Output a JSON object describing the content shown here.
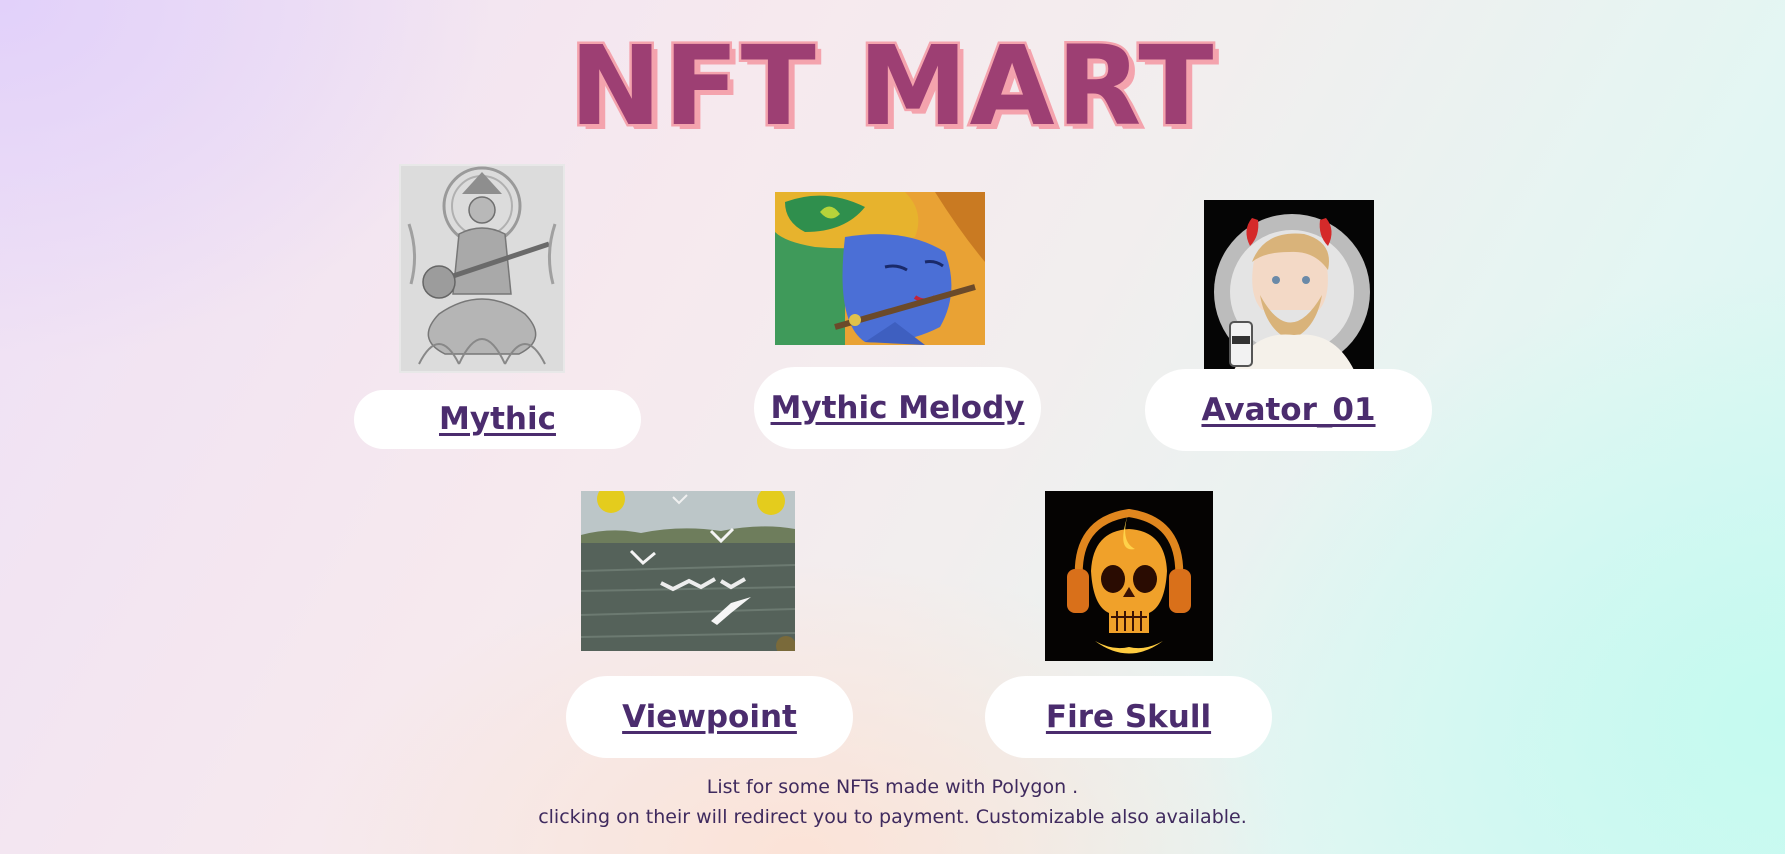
{
  "header": {
    "title": "NFT MART"
  },
  "nfts": [
    {
      "name": "Mythic",
      "image": "saraswati-pencil-sketch"
    },
    {
      "name": "Mythic Melody",
      "image": "krishna-flute-painting"
    },
    {
      "name": "Avator_01",
      "image": "bearded-devil-avatar"
    },
    {
      "name": "Viewpoint",
      "image": "seagulls-over-river-photo"
    },
    {
      "name": "Fire Skull",
      "image": "flaming-skull-headphones"
    }
  ],
  "footer": {
    "line1": "List for some NFTs made with Polygon .",
    "line2": "clicking on their will redirect you to payment. Customizable  also available."
  },
  "colors": {
    "title_fill": "#9d3f73",
    "title_outline": "#f4a3ad",
    "link_text": "#4b2c6e",
    "pill_background": "#ffffff"
  }
}
